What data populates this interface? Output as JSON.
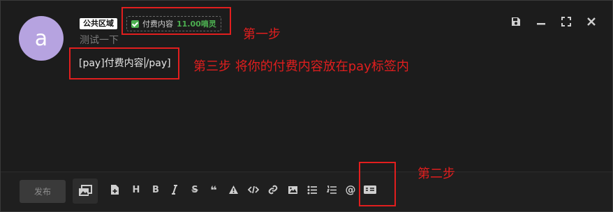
{
  "post": {
    "avatar_letter": "a",
    "visibility_badge": "公共区域",
    "pay_toggle_label": "付费内容",
    "pay_amount": "11.00嘀灵",
    "placeholder": "测试一下",
    "editor_text_before": "[pay]付费内容",
    "editor_text_after": "/pay]"
  },
  "annotations": {
    "step1": "第一步",
    "step2": "第二步",
    "step3": "第三步 将你的付费内容放在pay标签内"
  },
  "toolbar": {
    "publish_label": "发布",
    "heading_label": "H",
    "bold_label": "B",
    "italic_label": "I",
    "strike_label": "S",
    "quote_label": "❝",
    "at_label": "@"
  },
  "colors": {
    "accent_red": "#e21e1e",
    "pay_green": "#4caf50",
    "avatar": "#b6a3e0"
  }
}
